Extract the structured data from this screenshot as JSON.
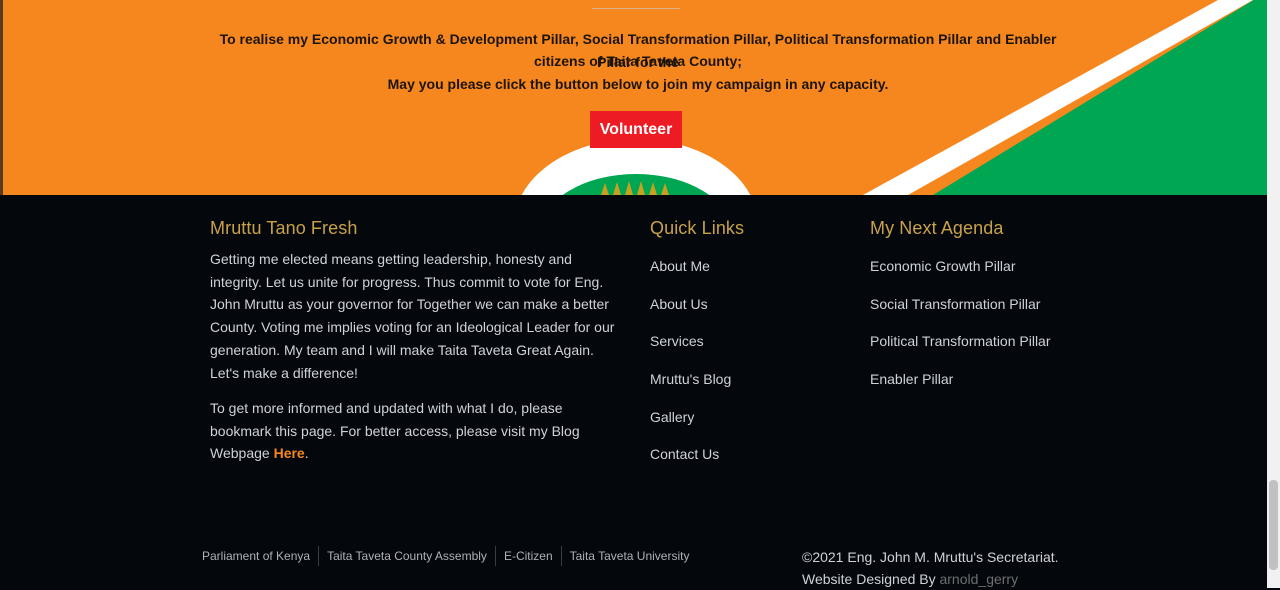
{
  "hero": {
    "line1": "To realise my Economic Growth & Development Pillar, Social Transformation Pillar, Political Transformation Pillar and Enabler Pillar for the",
    "line2": "citizens of Taita Taveta County;",
    "line3": "May you please click the button below to join my campaign in any capacity.",
    "button_label": "Volunteer",
    "colors": {
      "orange": "#f6871f",
      "green": "#00a651",
      "white": "#ffffff",
      "button": "#ed1c24"
    }
  },
  "footer": {
    "about": {
      "title": "Mruttu Tano Fresh",
      "paragraph1": "Getting me elected means getting leadership, honesty and integrity. Let us unite for progress. Thus commit to vote for Eng. John Mruttu as your governor for Together we can make a better County. Voting me implies voting for an Ideological Leader for our generation. My team and I will make Taita Taveta Great Again. Let's make a difference!",
      "paragraph2_prefix": "To get more informed and updated with what I do, please bookmark this page. For better access, please visit my Blog Webpage ",
      "paragraph2_link": "Here",
      "paragraph2_suffix": "."
    },
    "quick_links": {
      "title": "Quick Links",
      "items": [
        "About Me",
        "About Us",
        "Services",
        "Mruttu's Blog",
        "Gallery",
        "Contact Us"
      ]
    },
    "agenda": {
      "title": "My Next Agenda",
      "items": [
        "Economic Growth Pillar",
        "Social Transformation Pillar",
        "Political Transformation Pillar",
        "Enabler Pillar"
      ]
    },
    "bottom_links": [
      "Parliament of Kenya",
      "Taita Taveta County Assembly",
      "E-Citizen",
      "Taita Taveta University"
    ],
    "copyright": "©2021 Eng. John M. Mruttu's Secretariat.",
    "designed_by_prefix": "Website Designed By ",
    "designer": "arnold_gerry",
    "colors": {
      "background": "#04070c",
      "heading": "#c9a14a",
      "text": "#cfd3d8",
      "link_accent": "#f6871f"
    }
  }
}
